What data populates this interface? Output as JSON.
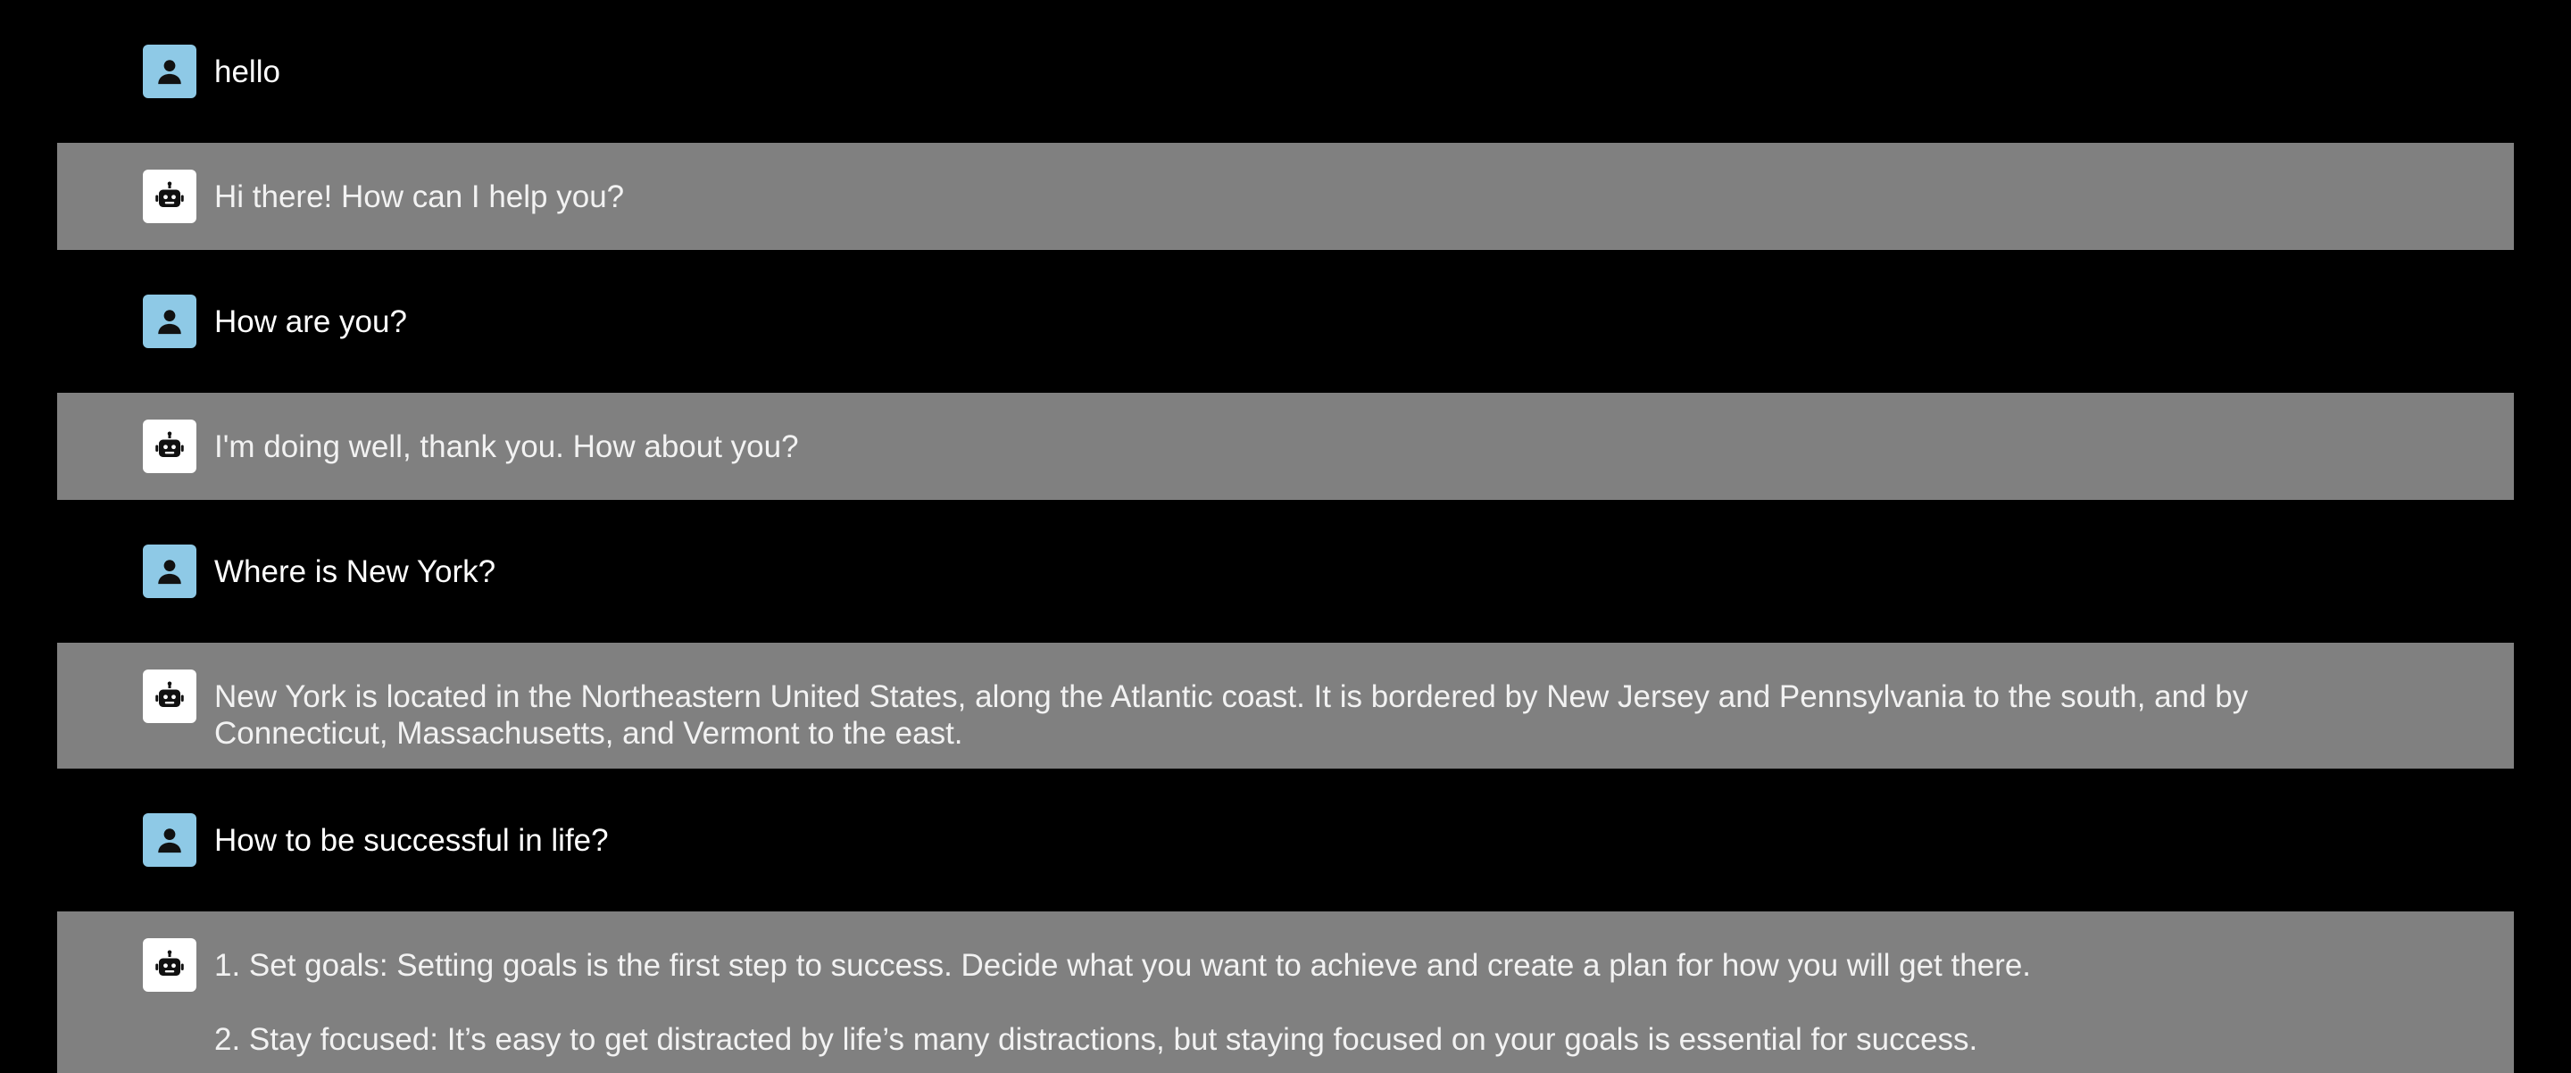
{
  "colors": {
    "page_background": "#000000",
    "bot_row_background": "#808080",
    "user_avatar_background": "#8ec9e6",
    "bot_avatar_background": "#ffffff",
    "user_text": "#ffffff",
    "bot_text": "#f2f2f2"
  },
  "icons": {
    "user": "person-icon",
    "bot": "robot-icon"
  },
  "messages": [
    {
      "role": "user",
      "paragraphs": [
        "hello"
      ]
    },
    {
      "role": "bot",
      "paragraphs": [
        "Hi there! How can I help you?"
      ]
    },
    {
      "role": "user",
      "paragraphs": [
        "How are you?"
      ]
    },
    {
      "role": "bot",
      "paragraphs": [
        "I'm doing well, thank you. How about you?"
      ]
    },
    {
      "role": "user",
      "paragraphs": [
        "Where is New York?"
      ]
    },
    {
      "role": "bot",
      "paragraphs": [
        "New York is located in the Northeastern United States, along the Atlantic coast. It is bordered by New Jersey and Pennsylvania to the south, and by Connecticut, Massachusetts, and Vermont to the east."
      ]
    },
    {
      "role": "user",
      "paragraphs": [
        "How to be successful in life?"
      ]
    },
    {
      "role": "bot",
      "paragraphs": [
        "1. Set goals: Setting goals is the first step to success. Decide what you want to achieve and create a plan for how you will get there.",
        "2. Stay focused: It’s easy to get distracted by life’s many distractions, but staying focused on your goals is essential for success."
      ]
    }
  ]
}
